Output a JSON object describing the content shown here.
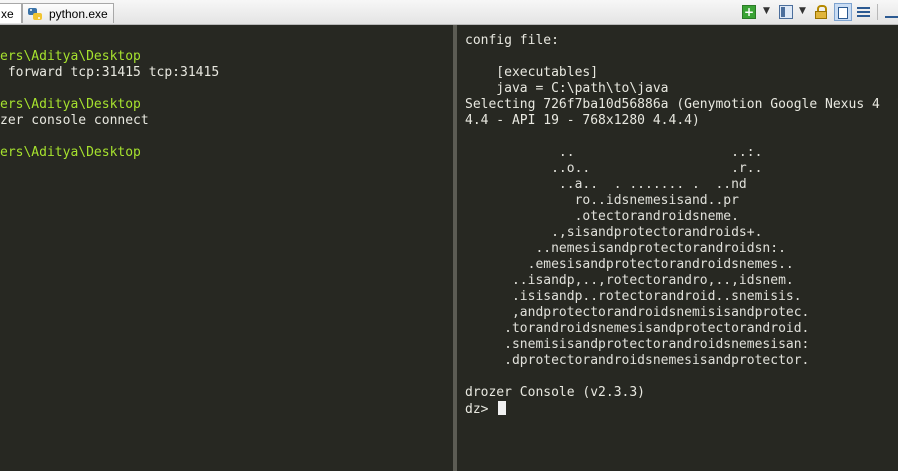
{
  "tabs": [
    {
      "label": "xe",
      "icon": "terminal-icon"
    },
    {
      "label": "python.exe",
      "icon": "python-icon"
    }
  ],
  "toolbar": {
    "icons": [
      "add-console-icon",
      "dropdown-arrow-icon",
      "layout-icon",
      "dropdown-arrow-icon",
      "lock-icon",
      "panel-icon",
      "list-icon",
      "minimize-icon"
    ],
    "add_glyph": "+",
    "dropdown_glyph": "▼"
  },
  "left_console": {
    "lines": [
      {
        "text": "ers\\Aditya\\Desktop",
        "color": "#a6e22e"
      },
      {
        "text": " forward tcp:31415 tcp:31415",
        "color": "#e8e8e0"
      },
      {
        "text": "",
        "color": "#e8e8e0"
      },
      {
        "text": "ers\\Aditya\\Desktop",
        "color": "#a6e22e"
      },
      {
        "text": "zer console connect",
        "color": "#e8e8e0"
      },
      {
        "text": "",
        "color": "#e8e8e0"
      },
      {
        "text": "ers\\Aditya\\Desktop",
        "color": "#a6e22e"
      }
    ]
  },
  "right_console": {
    "header_lines": [
      "config file:",
      "",
      "    [executables]",
      "    java = C:\\path\\to\\java",
      "Selecting 726f7ba10d56886a (Genymotion Google Nexus 4",
      "4.4 - API 19 - 768x1280 4.4.4)",
      ""
    ],
    "art_lines": [
      "            ..                    ..:.",
      "           ..o..                  .r..",
      "            ..a..  . ....... .  ..nd",
      "              ro..idsnemesisand..pr",
      "              .otectorandroidsneme.",
      "           .,sisandprotectorandroids+.",
      "         ..nemesisandprotectorandroidsn:.",
      "        .emesisandprotectorandroidsnemes..",
      "      ..isandp,..,rotectorandro,..,idsnem.",
      "      .isisandp..rotectorandroid..snemisis.",
      "      ,andprotectorandroidsnemisisandprotec.",
      "     .torandroidsnemesisandprotectorandroid.",
      "     .snemisisandprotectorandroidsnemesisan:",
      "     .dprotectorandroidsnemesisandprotector."
    ],
    "footer_lines": [
      "",
      "drozer Console (v2.3.3)"
    ],
    "prompt": "dz> "
  },
  "colors": {
    "background": "#272822",
    "path_green": "#a6e22e",
    "text": "#e8e8e0"
  }
}
